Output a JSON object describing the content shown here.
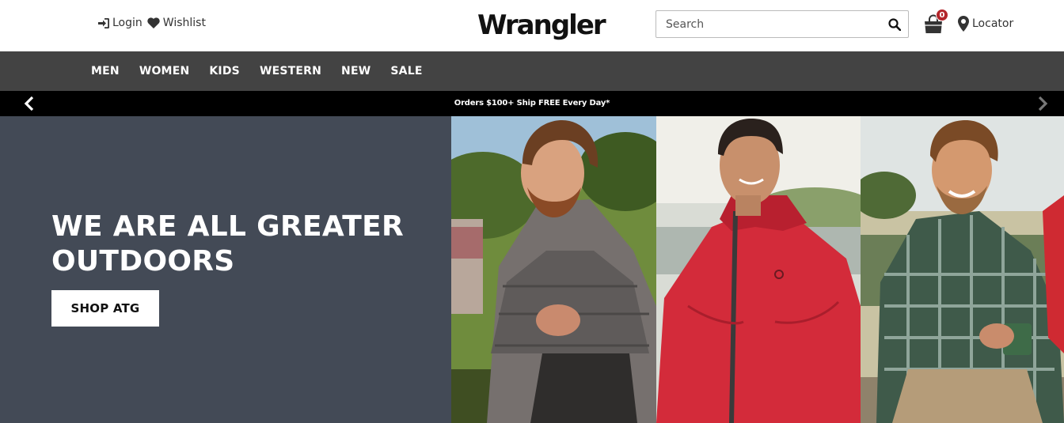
{
  "header": {
    "login_label": "Login",
    "wishlist_label": "Wishlist",
    "logo_text": "Wrangler",
    "search": {
      "placeholder": "Search",
      "value": ""
    },
    "cart_count": "0",
    "locator_label": "Locator"
  },
  "nav": {
    "items": [
      "MEN",
      "WOMEN",
      "KIDS",
      "WESTERN",
      "NEW",
      "SALE"
    ]
  },
  "promo": {
    "text": "Orders $100+ Ship FREE Every Day*"
  },
  "hero": {
    "headline": "WE ARE ALL GREATER OUTDOORS",
    "cta_label": "SHOP ATG"
  },
  "colors": {
    "nav_bg": "#434343",
    "promo_bg": "#000000",
    "hero_bg": "#434a56",
    "badge": "#b3262b"
  },
  "icons": {
    "login": "sign-in-icon",
    "wishlist": "heart-icon",
    "search": "search-icon",
    "cart": "shopping-bag-icon",
    "locator": "map-pin-icon",
    "prev": "chevron-left-icon",
    "next": "chevron-right-icon"
  }
}
